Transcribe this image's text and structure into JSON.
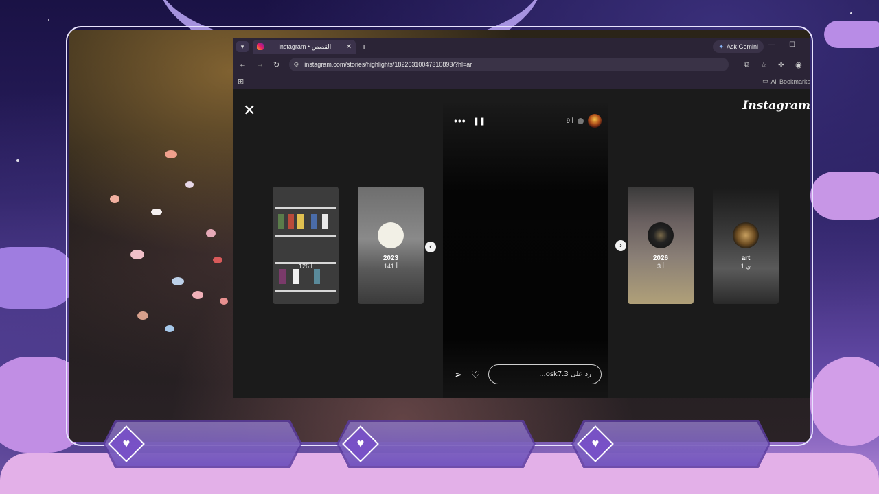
{
  "browser": {
    "tab_title": "Instagram • القصص",
    "new_tab": "+",
    "ask_gemini": "Ask Gemini",
    "url": "instagram.com/stories/highlights/18226310047310893/?hl=ar",
    "all_bookmarks": "All Bookmarks"
  },
  "instagram": {
    "logo": "Instagram",
    "story": {
      "username_time": "9 أ",
      "reply_placeholder": "رد على osk7.3..."
    },
    "highlights_left": [
      {
        "name": "",
        "time": "126 أ"
      },
      {
        "name": "2023",
        "time": "141 أ"
      }
    ],
    "highlights_right": [
      {
        "name": "2026",
        "time": "3 أ"
      },
      {
        "name": "art",
        "time": "1 ي"
      }
    ]
  }
}
